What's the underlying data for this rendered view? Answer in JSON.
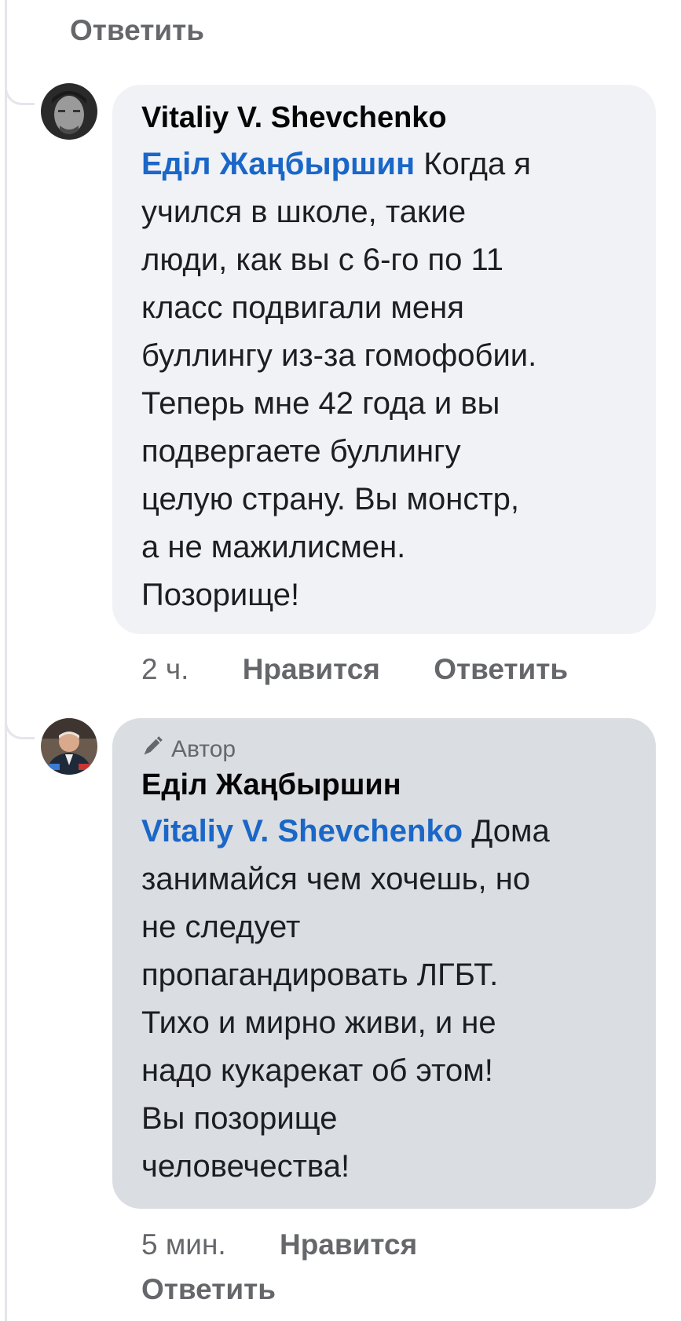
{
  "top_action": {
    "reply_label": "Ответить"
  },
  "comments": [
    {
      "author": "Vitaliy V. Shevchenko",
      "mention": "Еділ Жаңбыршин",
      "first_line_rest": " Когда я",
      "lines": [
        "учился в школе, такие",
        "люди, как вы с 6-го по 11",
        "класс подвигали меня",
        "буллингу из-за гомофобии.",
        "Теперь мне 42 года и вы",
        "подвергаете буллингу",
        "целую страну. Вы монстр,",
        "а не мажилисмен.",
        "Позорище!"
      ],
      "time": "2 ч.",
      "like_label": "Нравится",
      "reply_label": "Ответить"
    },
    {
      "badge": "Автор",
      "author": "Еділ Жаңбыршин",
      "mention": "Vitaliy V. Shevchenko",
      "first_line_rest": " Дома",
      "lines": [
        "занимайся чем хочешь, но",
        "не следует",
        "пропагандировать ЛГБТ.",
        "Тихо и мирно живи, и не",
        "надо кукарекат об этом!",
        "Вы позорище",
        "человечества!"
      ],
      "time": "5 мин.",
      "like_label": "Нравится",
      "reply_label": "Ответить"
    }
  ],
  "icons": {
    "badge_icon": "pencil-icon"
  }
}
